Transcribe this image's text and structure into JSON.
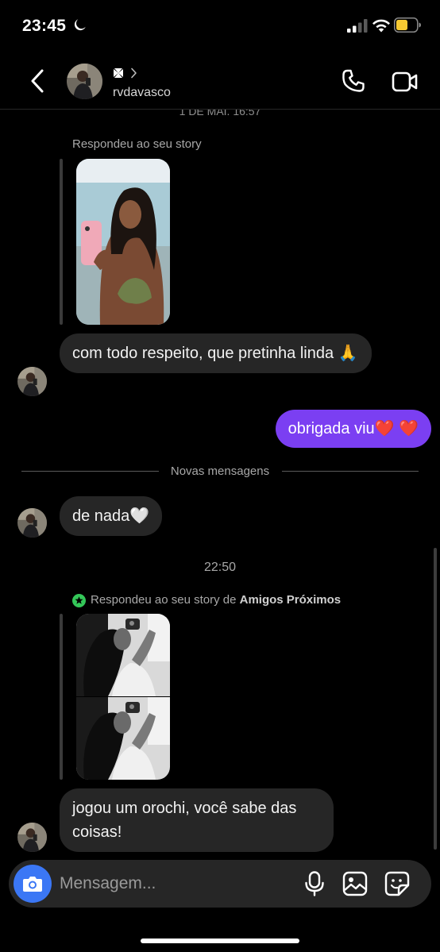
{
  "status_bar": {
    "time": "23:45",
    "icons": [
      "moon-icon",
      "signal-icon",
      "wifi-icon",
      "battery-icon"
    ]
  },
  "header": {
    "display_name_icon": "maltese-cross-icon",
    "username": "rvdavasco",
    "icons": [
      "back-chevron-icon",
      "phone-icon",
      "video-camera-icon"
    ]
  },
  "thread": {
    "cut_date": "1 DE MAI. 16:57",
    "story_reply_1": {
      "label": "Respondeu ao seu story"
    },
    "message_1": "com todo respeito, que pretinha linda 🙏",
    "message_2_sent": "obrigada viu❤️ ❤️",
    "new_messages_divider": "Novas mensagens",
    "message_3": "de nada🤍",
    "time_separator": "22:50",
    "story_reply_2": {
      "label_prefix": "Respondeu ao seu story de ",
      "label_bold": "Amigos Próximos",
      "badge_icon": "close-friends-star-icon"
    },
    "message_4": "jogou um orochi, você sabe das coisas!"
  },
  "composer": {
    "placeholder": "Mensagem...",
    "icons": [
      "camera-icon",
      "microphone-icon",
      "gallery-icon",
      "sticker-icon"
    ]
  },
  "colors": {
    "background": "#000000",
    "incoming_bubble": "#262626",
    "outgoing_bubble": "#7b3ff2",
    "camera_button": "#3b77f5",
    "close_friends_green": "#34c759"
  }
}
